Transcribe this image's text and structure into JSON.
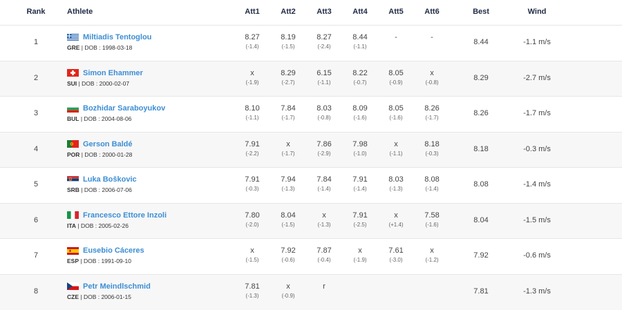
{
  "header": {
    "rank": "Rank",
    "athlete": "Athlete",
    "att1": "Att1",
    "att2": "Att2",
    "att3": "Att3",
    "att4": "Att4",
    "att5": "Att5",
    "att6": "Att6",
    "best": "Best",
    "wind": "Wind"
  },
  "rows": [
    {
      "rank": "1",
      "name": "Miltiadis Tentoglou",
      "country": "GRE",
      "dob": "DOB : 1998-03-18",
      "flag": "greece-flag-icon",
      "attempts": [
        {
          "mark": "8.27",
          "wind": "(-1.4)"
        },
        {
          "mark": "8.19",
          "wind": "(-1.5)"
        },
        {
          "mark": "8.27",
          "wind": "(-2.4)"
        },
        {
          "mark": "8.44",
          "wind": "(-1.1)"
        },
        {
          "mark": "-",
          "wind": ""
        },
        {
          "mark": "-",
          "wind": ""
        }
      ],
      "best": "8.44",
      "wind": "-1.1 m/s"
    },
    {
      "rank": "2",
      "name": "Simon Ehammer",
      "country": "SUI",
      "dob": "DOB : 2000-02-07",
      "flag": "switzerland-flag-icon",
      "attempts": [
        {
          "mark": "x",
          "wind": "(-1.9)"
        },
        {
          "mark": "8.29",
          "wind": "(-2.7)"
        },
        {
          "mark": "6.15",
          "wind": "(-1.1)"
        },
        {
          "mark": "8.22",
          "wind": "(-0.7)"
        },
        {
          "mark": "8.05",
          "wind": "(-0.9)"
        },
        {
          "mark": "x",
          "wind": "(-0.8)"
        }
      ],
      "best": "8.29",
      "wind": "-2.7 m/s"
    },
    {
      "rank": "3",
      "name": "Bozhidar Saraboyukov",
      "country": "BUL",
      "dob": "DOB : 2004-08-06",
      "flag": "bulgaria-flag-icon",
      "attempts": [
        {
          "mark": "8.10",
          "wind": "(-1.1)"
        },
        {
          "mark": "7.84",
          "wind": "(-1.7)"
        },
        {
          "mark": "8.03",
          "wind": "(-0.8)"
        },
        {
          "mark": "8.09",
          "wind": "(-1.6)"
        },
        {
          "mark": "8.05",
          "wind": "(-1.6)"
        },
        {
          "mark": "8.26",
          "wind": "(-1.7)"
        }
      ],
      "best": "8.26",
      "wind": "-1.7 m/s"
    },
    {
      "rank": "4",
      "name": "Gerson Baldé",
      "country": "POR",
      "dob": "DOB : 2000-01-28",
      "flag": "portugal-flag-icon",
      "attempts": [
        {
          "mark": "7.91",
          "wind": "(-2.2)"
        },
        {
          "mark": "x",
          "wind": "(-1.7)"
        },
        {
          "mark": "7.86",
          "wind": "(-2.9)"
        },
        {
          "mark": "7.98",
          "wind": "(-1.0)"
        },
        {
          "mark": "x",
          "wind": "(-1.1)"
        },
        {
          "mark": "8.18",
          "wind": "(-0.3)"
        }
      ],
      "best": "8.18",
      "wind": "-0.3 m/s"
    },
    {
      "rank": "5",
      "name": "Luka Boškovic",
      "country": "SRB",
      "dob": "DOB : 2006-07-06",
      "flag": "serbia-flag-icon",
      "attempts": [
        {
          "mark": "7.91",
          "wind": "(-0.3)"
        },
        {
          "mark": "7.94",
          "wind": "(-1.3)"
        },
        {
          "mark": "7.84",
          "wind": "(-1.4)"
        },
        {
          "mark": "7.91",
          "wind": "(-1.4)"
        },
        {
          "mark": "8.03",
          "wind": "(-1.3)"
        },
        {
          "mark": "8.08",
          "wind": "(-1.4)"
        }
      ],
      "best": "8.08",
      "wind": "-1.4 m/s"
    },
    {
      "rank": "6",
      "name": "Francesco Ettore Inzoli",
      "country": "ITA",
      "dob": "DOB : 2005-02-26",
      "flag": "italy-flag-icon",
      "attempts": [
        {
          "mark": "7.80",
          "wind": "(-2.0)"
        },
        {
          "mark": "8.04",
          "wind": "(-1.5)"
        },
        {
          "mark": "x",
          "wind": "(-1.3)"
        },
        {
          "mark": "7.91",
          "wind": "(-2.5)"
        },
        {
          "mark": "x",
          "wind": "(+1.4)"
        },
        {
          "mark": "7.58",
          "wind": "(-1.6)"
        }
      ],
      "best": "8.04",
      "wind": "-1.5 m/s"
    },
    {
      "rank": "7",
      "name": "Eusebio Cáceres",
      "country": "ESP",
      "dob": "DOB : 1991-09-10",
      "flag": "spain-flag-icon",
      "attempts": [
        {
          "mark": "x",
          "wind": "(-1.5)"
        },
        {
          "mark": "7.92",
          "wind": "(-0.6)"
        },
        {
          "mark": "7.87",
          "wind": "(-0.4)"
        },
        {
          "mark": "x",
          "wind": "(-1.9)"
        },
        {
          "mark": "7.61",
          "wind": "(-3.0)"
        },
        {
          "mark": "x",
          "wind": "(-1.2)"
        }
      ],
      "best": "7.92",
      "wind": "-0.6 m/s"
    },
    {
      "rank": "8",
      "name": "Petr Meindlschmid",
      "country": "CZE",
      "dob": "DOB : 2006-01-15",
      "flag": "czechia-flag-icon",
      "attempts": [
        {
          "mark": "7.81",
          "wind": "(-1.3)"
        },
        {
          "mark": "x",
          "wind": "(-0.9)"
        },
        {
          "mark": "r",
          "wind": ""
        },
        {
          "mark": "",
          "wind": ""
        },
        {
          "mark": "",
          "wind": ""
        },
        {
          "mark": "",
          "wind": ""
        }
      ],
      "best": "7.81",
      "wind": "-1.3 m/s"
    }
  ]
}
